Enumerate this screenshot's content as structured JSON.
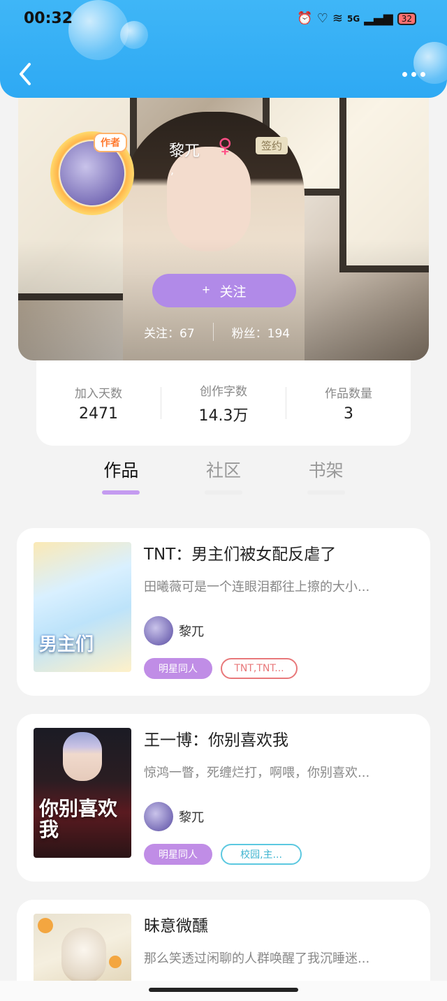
{
  "status_bar": {
    "time": "00:32",
    "network": "5G",
    "battery": "32"
  },
  "profile": {
    "author_badge": "作者",
    "name": "黎兀",
    "gender_symbol": "♀",
    "signed_label": "签约",
    "signature": ",",
    "follow_plus": "+",
    "follow_label": "关注",
    "following_text": "关注：67",
    "fans_text": "粉丝：194"
  },
  "stats": [
    {
      "label": "加入天数",
      "value": "2471"
    },
    {
      "label": "创作字数",
      "value": "14.3万"
    },
    {
      "label": "作品数量",
      "value": "3"
    }
  ],
  "tabs": [
    {
      "label": "作品",
      "active": true
    },
    {
      "label": "社区",
      "active": false
    },
    {
      "label": "书架",
      "active": false
    }
  ],
  "books": [
    {
      "title": "TNT：男主们被女配反虐了",
      "desc": "田曦薇可是一个连眼泪都往上擦的大小...",
      "author": "黎兀",
      "tag1": "明星同人",
      "tag2": "TNT,TNT...",
      "tag2_color": "#e8787a",
      "cover_text": "男主们"
    },
    {
      "title": "王一博：你别喜欢我",
      "desc": "惊鸿一瞥，死缠烂打，啊喂，你别喜欢...",
      "author": "黎兀",
      "tag1": "明星同人",
      "tag2": "校园,主...",
      "tag2_color": "#5cc8e0",
      "cover_text": "你别喜欢我"
    },
    {
      "title": "昧意微醺",
      "desc": "那么笑透过闲聊的人群唤醒了我沉睡迷..."
    }
  ]
}
